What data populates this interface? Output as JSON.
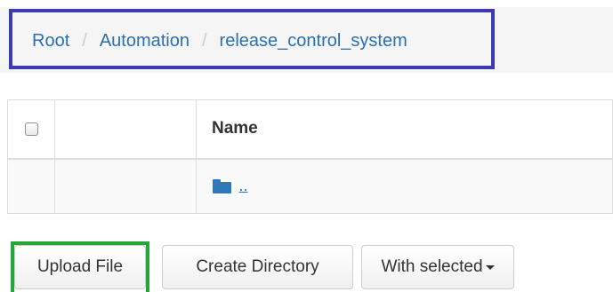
{
  "breadcrumb": {
    "items": [
      "Root",
      "Automation",
      "release_control_system"
    ],
    "separator": "/"
  },
  "table": {
    "header_name": "Name",
    "rows": [
      {
        "icon": "folder-icon",
        "label": ".."
      }
    ]
  },
  "buttons": {
    "upload": "Upload File",
    "create_directory": "Create Directory",
    "with_selected": "With selected"
  },
  "colors": {
    "link": "#2a6fb0",
    "breadcrumb_highlight": "#3b3bb3",
    "upload_highlight": "#26a638",
    "folder": "#2f77bc"
  }
}
